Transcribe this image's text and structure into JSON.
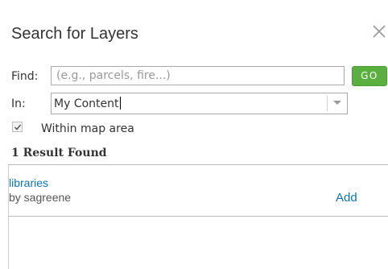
{
  "dialog": {
    "title": "Search for Layers",
    "close_icon": "close-icon"
  },
  "search": {
    "find_label": "Find:",
    "find_value": "",
    "find_placeholder": "(e.g., parcels, fire...)",
    "go_label": "GO",
    "in_label": "In:",
    "in_selected": "My Content",
    "within_label": "Within map area",
    "within_checked": true
  },
  "results": {
    "count_label": "1 Result Found",
    "items": [
      {
        "title": "libraries",
        "owner": "by sagreene",
        "action": "Add"
      }
    ]
  },
  "colors": {
    "go_button": "#5ab03f",
    "link": "#0b74b7"
  }
}
